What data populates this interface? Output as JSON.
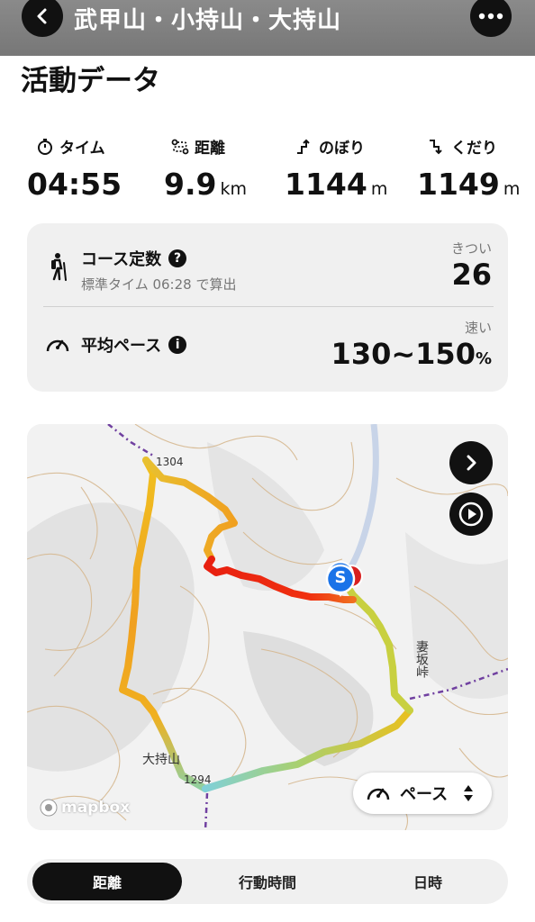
{
  "header": {
    "title": "武甲山・小持山・大持山",
    "back_icon": "chevron-left-icon",
    "more_icon": "ellipsis-icon"
  },
  "section_title": "活動データ",
  "stats": [
    {
      "label": "タイム",
      "icon": "stopwatch-icon",
      "value": "04:55",
      "unit": ""
    },
    {
      "label": "距離",
      "icon": "route-icon",
      "value": "9.9",
      "unit": "km"
    },
    {
      "label": "のぼり",
      "icon": "ascent-icon",
      "value": "1144",
      "unit": "m"
    },
    {
      "label": "くだり",
      "icon": "descent-icon",
      "value": "1149",
      "unit": "m"
    }
  ],
  "course": {
    "title": "コース定数",
    "subtitle": "標準タイム 06:28 で算出",
    "right_label": "きつい",
    "value": "26"
  },
  "pace": {
    "title": "平均ペース",
    "right_label": "速い",
    "value": "130~150",
    "unit": "%"
  },
  "map": {
    "labels": {
      "peak1": "1304",
      "peak2": "1294",
      "pass": "妻坂峠",
      "mountain": "大持山"
    },
    "attribution": "mapbox",
    "pace_button": "ペース",
    "start_marker": "S"
  },
  "tabs": [
    {
      "label": "距離",
      "active": true
    },
    {
      "label": "行動時間",
      "active": false
    },
    {
      "label": "日時",
      "active": false
    }
  ]
}
